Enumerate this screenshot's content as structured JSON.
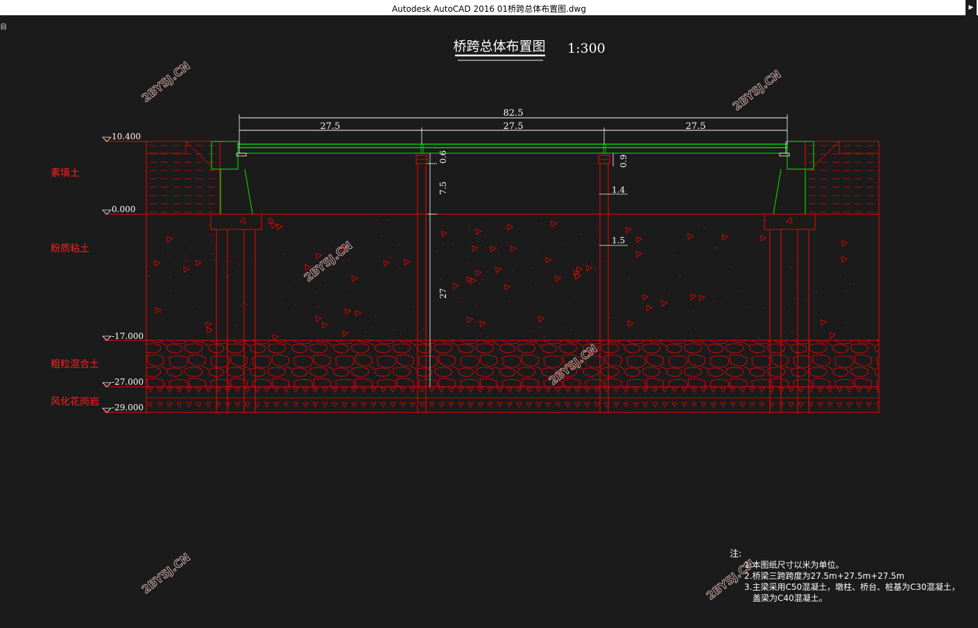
{
  "window": {
    "title": "Autodesk AutoCAD 2016     01桥跨总体布置图.dwg",
    "corner_glyph": "自"
  },
  "drawing": {
    "title": "桥跨总体布置图",
    "scale": "1:300",
    "dims": {
      "total": "82.5",
      "span1": "27.5",
      "span2": "27.5",
      "span3": "27.5",
      "beam_depth_left": "0.6",
      "beam_depth_right": "0.9",
      "pier_height": "7.5",
      "pile_length": "27",
      "pier_width": "1.4",
      "pile_width": "1.5"
    },
    "elevations": [
      "10.400",
      "0.000",
      "-17.000",
      "-27.000",
      "-29.000"
    ],
    "soil_layers": [
      "素填土",
      "粉质粘土",
      "粗粒混合土",
      "风化花岗岩"
    ],
    "notes": {
      "heading": "注:",
      "lines": [
        "1.本图纸尺寸以米为单位。",
        "2.桥梁三跨跨度为27.5m+27.5m+27.5m",
        "3.主梁采用C50混凝土，墩柱、桥台、桩基为C30混凝土，",
        "盖梁为C40混凝土。"
      ]
    },
    "watermark": "2BYSJ.CN",
    "colors": {
      "background": "#1b1b1b",
      "red": "#ff0000",
      "green": "#00d000",
      "white": "#ffffff"
    }
  }
}
